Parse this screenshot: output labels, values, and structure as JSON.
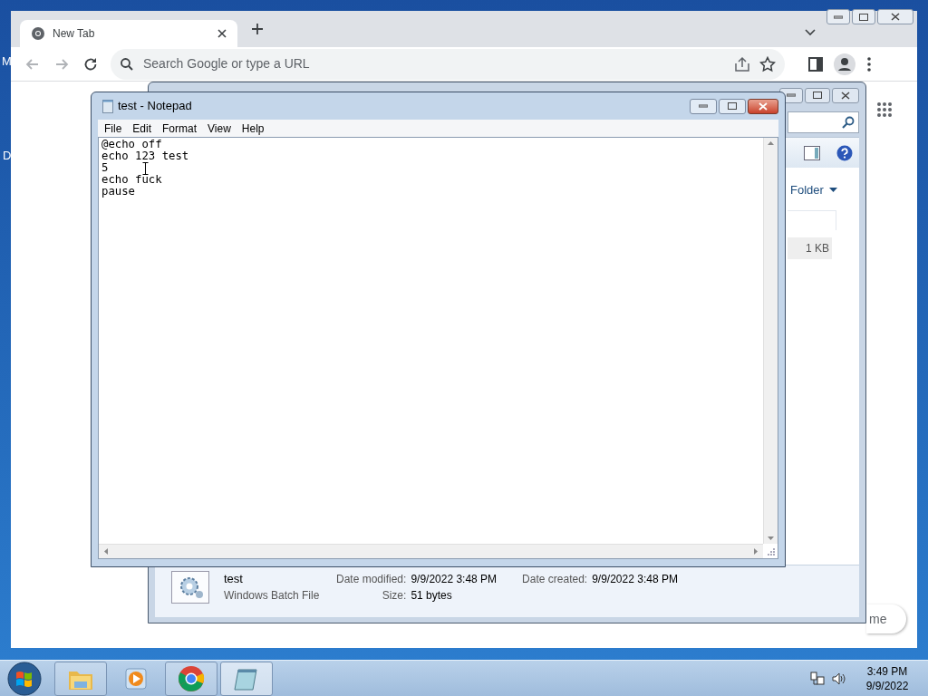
{
  "desktop": {
    "labels": [
      "M",
      "D"
    ]
  },
  "chrome": {
    "tabs": [
      {
        "title": "New Tab",
        "selected": true
      }
    ],
    "omnibox": {
      "placeholder": "Search Google or type a URL"
    },
    "corner_button": {
      "label": "me"
    }
  },
  "explorer": {
    "toolbar_link": "Folder",
    "size_cell": "1 KB",
    "details": {
      "name": "test",
      "type": "Windows Batch File",
      "fields": [
        {
          "label": "Date modified:",
          "value": "9/9/2022 3:48 PM"
        },
        {
          "label": "Size:",
          "value": "51 bytes"
        },
        {
          "label": "Date created:",
          "value": "9/9/2022 3:48 PM"
        }
      ]
    }
  },
  "notepad": {
    "title": "test - Notepad",
    "menu": [
      "File",
      "Edit",
      "Format",
      "View",
      "Help"
    ],
    "lines": [
      "@echo off",
      "echo 123 test",
      "5",
      "echo fuck",
      "pause"
    ]
  },
  "taskbar": {
    "items": [
      {
        "kind": "explorer",
        "open": true,
        "selected": false
      },
      {
        "kind": "media",
        "open": false,
        "selected": false
      },
      {
        "kind": "chrome",
        "open": true,
        "selected": false
      },
      {
        "kind": "notepad",
        "open": true,
        "selected": true
      }
    ],
    "time": "3:49 PM",
    "date": "9/9/2022"
  }
}
